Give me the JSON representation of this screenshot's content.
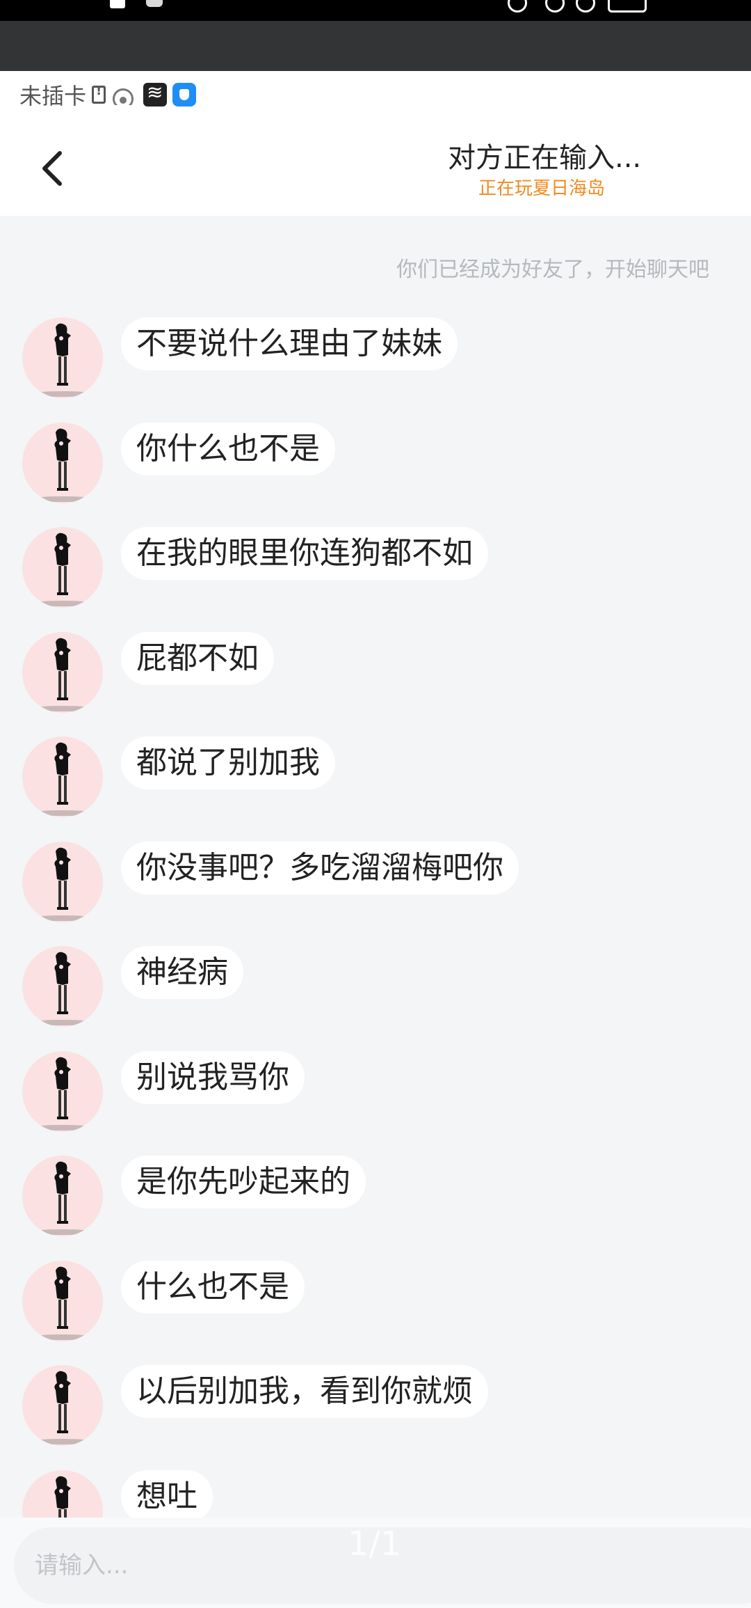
{
  "status_bar": {
    "carrier": "未插卡",
    "icons": [
      "sim-error-icon",
      "wifi-icon",
      "app-icon-1",
      "app-icon-2"
    ]
  },
  "header": {
    "back_icon": "chevron-left-icon",
    "title": "对方正在输入...",
    "subtitle": "正在玩夏日海岛"
  },
  "chat": {
    "system_note": "你们已经成为好友了，开始聊天吧",
    "messages": [
      {
        "text": "不要说什么理由了妹妹"
      },
      {
        "text": "你什么也不是"
      },
      {
        "text": "在我的眼里你连狗都不如"
      },
      {
        "text": "屁都不如"
      },
      {
        "text": "都说了别加我"
      },
      {
        "text": "你没事吧？多吃溜溜梅吧你"
      },
      {
        "text": "神经病"
      },
      {
        "text": "别说我骂你"
      },
      {
        "text": "是你先吵起来的"
      },
      {
        "text": "什么也不是"
      },
      {
        "text": "以后别加我，看到你就烦"
      },
      {
        "text": "想吐"
      }
    ]
  },
  "input": {
    "placeholder": "请输入..."
  },
  "page_indicator": "1/1",
  "colors": {
    "chat_background": "#f3f5f7",
    "bubble": "#ffffff",
    "subtitle": "#f08a1e",
    "avatar_background": "#fbe1e1"
  }
}
